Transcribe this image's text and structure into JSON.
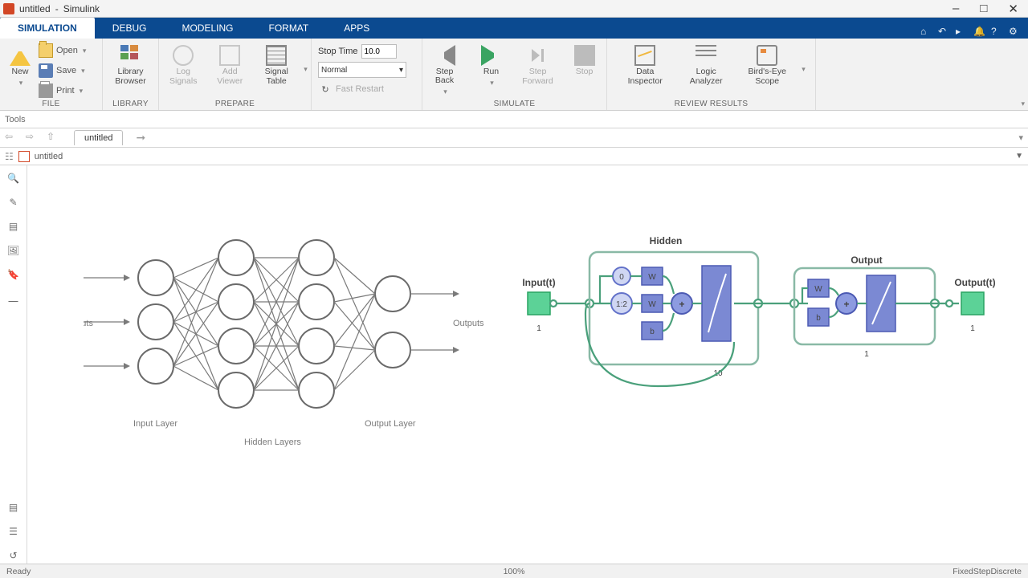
{
  "title": {
    "doc": "untitled",
    "app": "Simulink"
  },
  "tabs": [
    "SIMULATION",
    "DEBUG",
    "MODELING",
    "FORMAT",
    "APPS"
  ],
  "ribbon": {
    "file": {
      "new": "New",
      "open": "Open",
      "save": "Save",
      "print": "Print",
      "group": "FILE"
    },
    "library": {
      "browser": "Library\nBrowser",
      "group": "LIBRARY"
    },
    "prepare": {
      "log": "Log\nSignals",
      "add": "Add\nViewer",
      "table": "Signal\nTable",
      "group": "PREPARE"
    },
    "sim": {
      "stoptime_lbl": "Stop Time",
      "stoptime_val": "10.0",
      "mode": "Normal",
      "fast": "Fast Restart",
      "back": "Step\nBack",
      "run": "Run",
      "fwd": "Step\nForward",
      "stop": "Stop",
      "group": "SIMULATE"
    },
    "review": {
      "di": "Data\nInspector",
      "la": "Logic\nAnalyzer",
      "bird": "Bird's-Eye\nScope",
      "group": "REVIEW RESULTS"
    }
  },
  "tools_label": "Tools",
  "doc_tab": "untitled",
  "addr": "untitled",
  "nn_labels": {
    "inputs": "Inputs",
    "outputs": "Outputs",
    "input_layer": "Input Layer",
    "hidden_layers": "Hidden Layers",
    "output_layer": "Output Layer"
  },
  "snn": {
    "hidden_title": "Hidden",
    "output_title": "Output",
    "input_lbl": "Input(t)",
    "output_lbl": "Output(t)",
    "in_idx": "1",
    "hidden_idx": "10",
    "out_idx": "1",
    "out_port_idx": "1",
    "zero": "0",
    "delay": "1:2",
    "w": "W",
    "b": "b"
  },
  "status": {
    "ready": "Ready",
    "zoom": "100%",
    "solver": "FixedStepDiscrete"
  }
}
